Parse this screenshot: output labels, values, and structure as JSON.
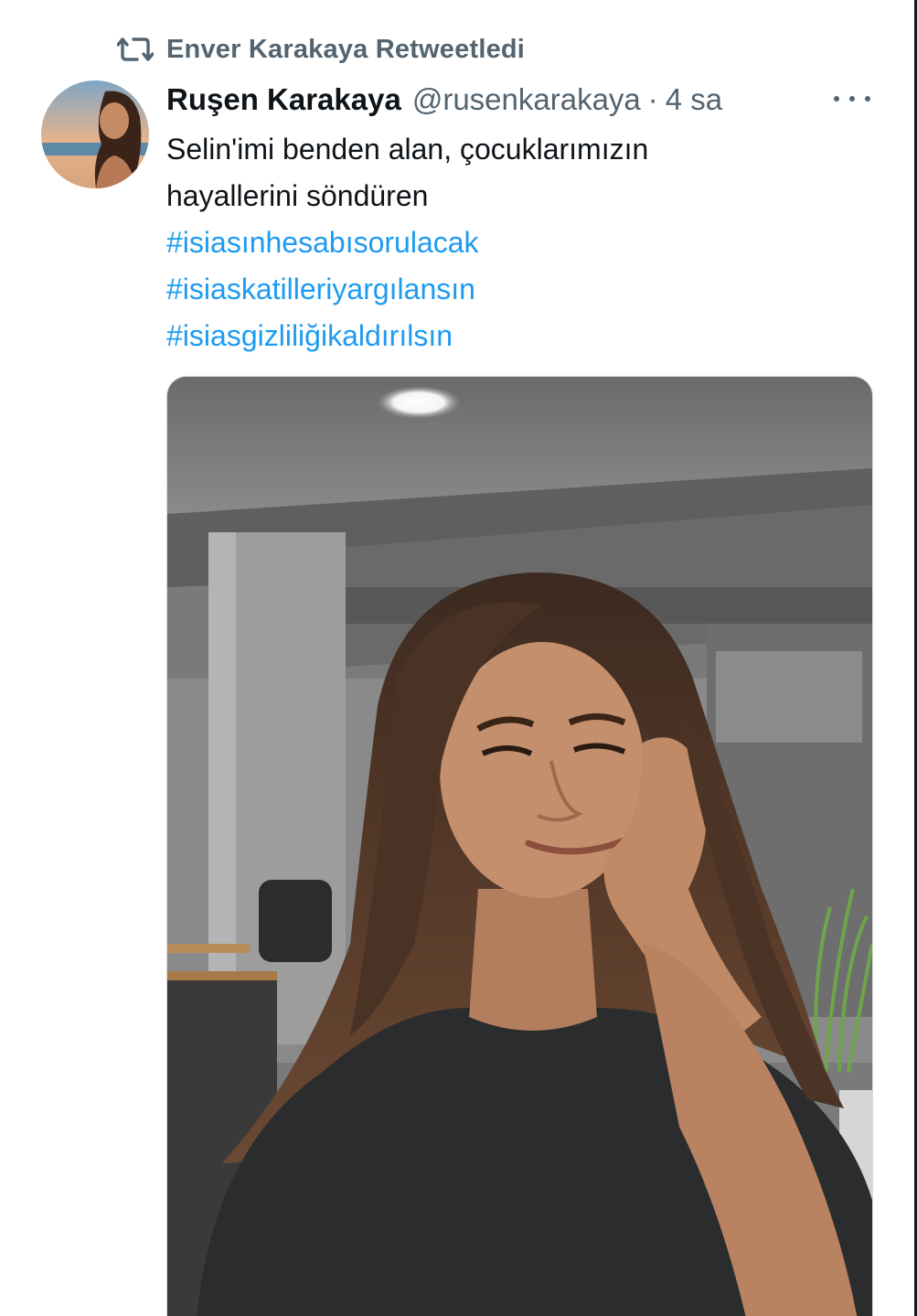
{
  "retweet": {
    "label": "Enver Karakaya Retweetledi",
    "icon": "retweet-icon"
  },
  "tweet": {
    "author": {
      "display_name": "Ruşen Karakaya",
      "handle": "@rusenkarakaya",
      "separator": "·",
      "time": "4 sa"
    },
    "text_lines": [
      "Selin'imi benden alan, çocuklarımızın",
      "hayallerini söndüren"
    ],
    "hashtags": [
      "#isiasınhesabısorulacak",
      "#isiaskatilleriyargılansın",
      "#isiasgizliliğikaldırılsın"
    ],
    "more_icon": "more-horizontal-icon"
  },
  "colors": {
    "text_primary": "#0f1419",
    "text_secondary": "#536471",
    "accent": "#1d9bf0"
  }
}
